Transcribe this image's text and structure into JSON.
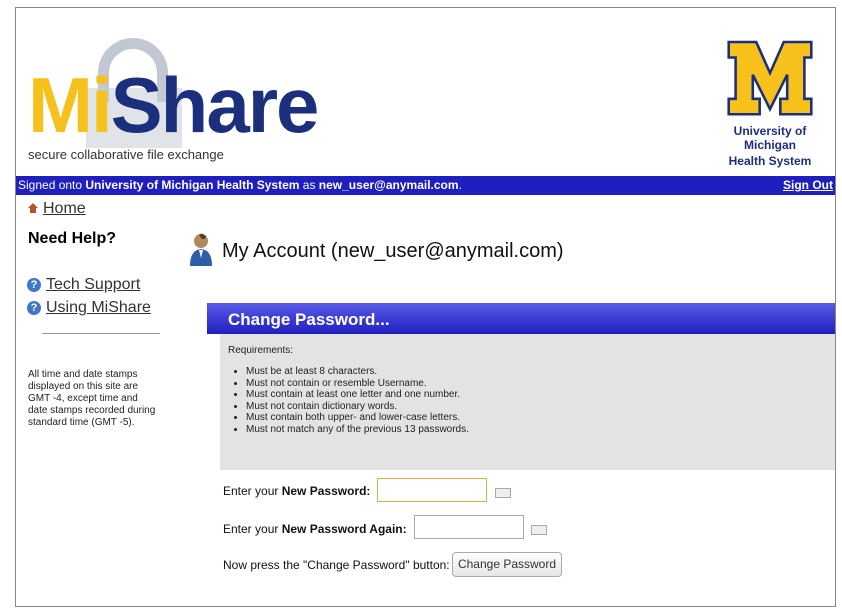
{
  "logo": {
    "brand_mi": "Mi",
    "brand_share": "Share",
    "tagline": "secure collaborative file exchange"
  },
  "org_logo": {
    "line1": "University of Michigan",
    "line2": "Health System"
  },
  "bar": {
    "prefix": "Signed onto ",
    "org": "University of Michigan Health System",
    "as": " as ",
    "user": "new_user@anymail.com",
    "suffix": ".",
    "sign_out": "Sign Out"
  },
  "nav": {
    "home": "Home",
    "need_help": "Need Help?",
    "tech_support": "Tech Support",
    "using": "Using MiShare",
    "time_note": "All time and date stamps displayed on this site are GMT -4, except time and date stamps recorded during standard time (GMT -5)."
  },
  "account": {
    "title": "My Account (new_user@anymail.com)"
  },
  "panel": {
    "title": "Change Password...",
    "req_label": "Requirements:",
    "requirements": [
      "Must be at least 8 characters.",
      "Must not contain or resemble Username.",
      "Must contain at least one letter and one number.",
      "Must not contain dictionary words.",
      "Must contain both upper- and lower-case letters.",
      "Must not match any of the previous 13 passwords."
    ]
  },
  "form": {
    "enter_your": "Enter your ",
    "new_pw": "New Password:",
    "new_pw_again": "New Password Again:",
    "new_pw_value": "",
    "new_pw_again_value": "",
    "press_text": "Now press the \"Change Password\" button:",
    "button": "Change Password"
  },
  "colors": {
    "bar": "#1f1fbf",
    "brand_yellow": "#f7c11c",
    "brand_blue": "#1c2f7c"
  }
}
